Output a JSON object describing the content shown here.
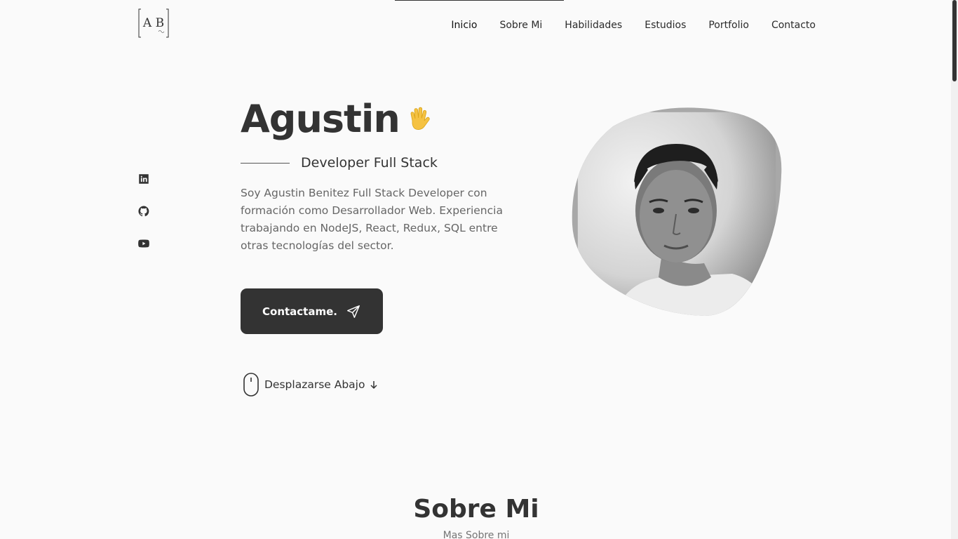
{
  "logo": {
    "text": "A B"
  },
  "nav": [
    {
      "label": "Inicio"
    },
    {
      "label": "Sobre Mi"
    },
    {
      "label": "Habilidades"
    },
    {
      "label": "Estudios"
    },
    {
      "label": "Portfolio"
    },
    {
      "label": "Contacto"
    }
  ],
  "social": [
    {
      "icon": "linkedin-icon"
    },
    {
      "icon": "github-icon"
    },
    {
      "icon": "youtube-icon"
    }
  ],
  "hero": {
    "name": "Agustin",
    "hand_icon": "waving-hand-icon",
    "subtitle": "Developer Full Stack",
    "description": "Soy Agustin Benitez Full Stack Developer con formación como Desarrollador Web. Experiencia trabajando en NodeJS, React, Redux, SQL entre otras tecnologías del sector.",
    "contact_button": "Contactame.",
    "scroll_label": "Desplazarse Abajo"
  },
  "section": {
    "title": "Sobre Mi",
    "subtitle": "Mas Sobre mi"
  },
  "colors": {
    "background": "#fafafa",
    "primary": "#333333",
    "text_muted": "#666666"
  }
}
